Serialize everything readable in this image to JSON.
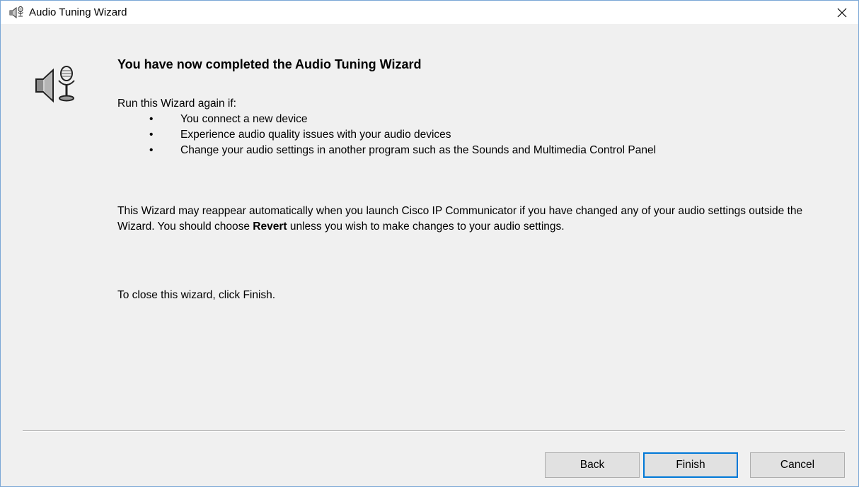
{
  "window": {
    "title": "Audio Tuning Wizard",
    "icon": "speaker-microphone-icon",
    "close_glyph": "close-icon"
  },
  "content": {
    "heading": "You have now completed the Audio Tuning Wizard",
    "intro": "Run this Wizard again if:",
    "bullets": [
      "You connect a new device",
      "Experience audio quality issues with your audio devices",
      "Change your audio settings in another program such as the Sounds and Multimedia Control Panel"
    ],
    "bullet_char": "•",
    "paragraph2_before": "This Wizard may reappear automatically when you launch Cisco IP Communicator if you have changed any of your audio settings outside the Wizard. You should choose ",
    "paragraph2_bold": "Revert",
    "paragraph2_after": " unless you wish to make changes to your audio settings.",
    "paragraph3": "To close this wizard, click Finish."
  },
  "buttons": {
    "back": "Back",
    "finish": "Finish",
    "cancel": "Cancel"
  },
  "colors": {
    "window_border": "#7aa7d6",
    "dialog_background": "#f0f0f0",
    "default_button_border": "#0078d7"
  }
}
